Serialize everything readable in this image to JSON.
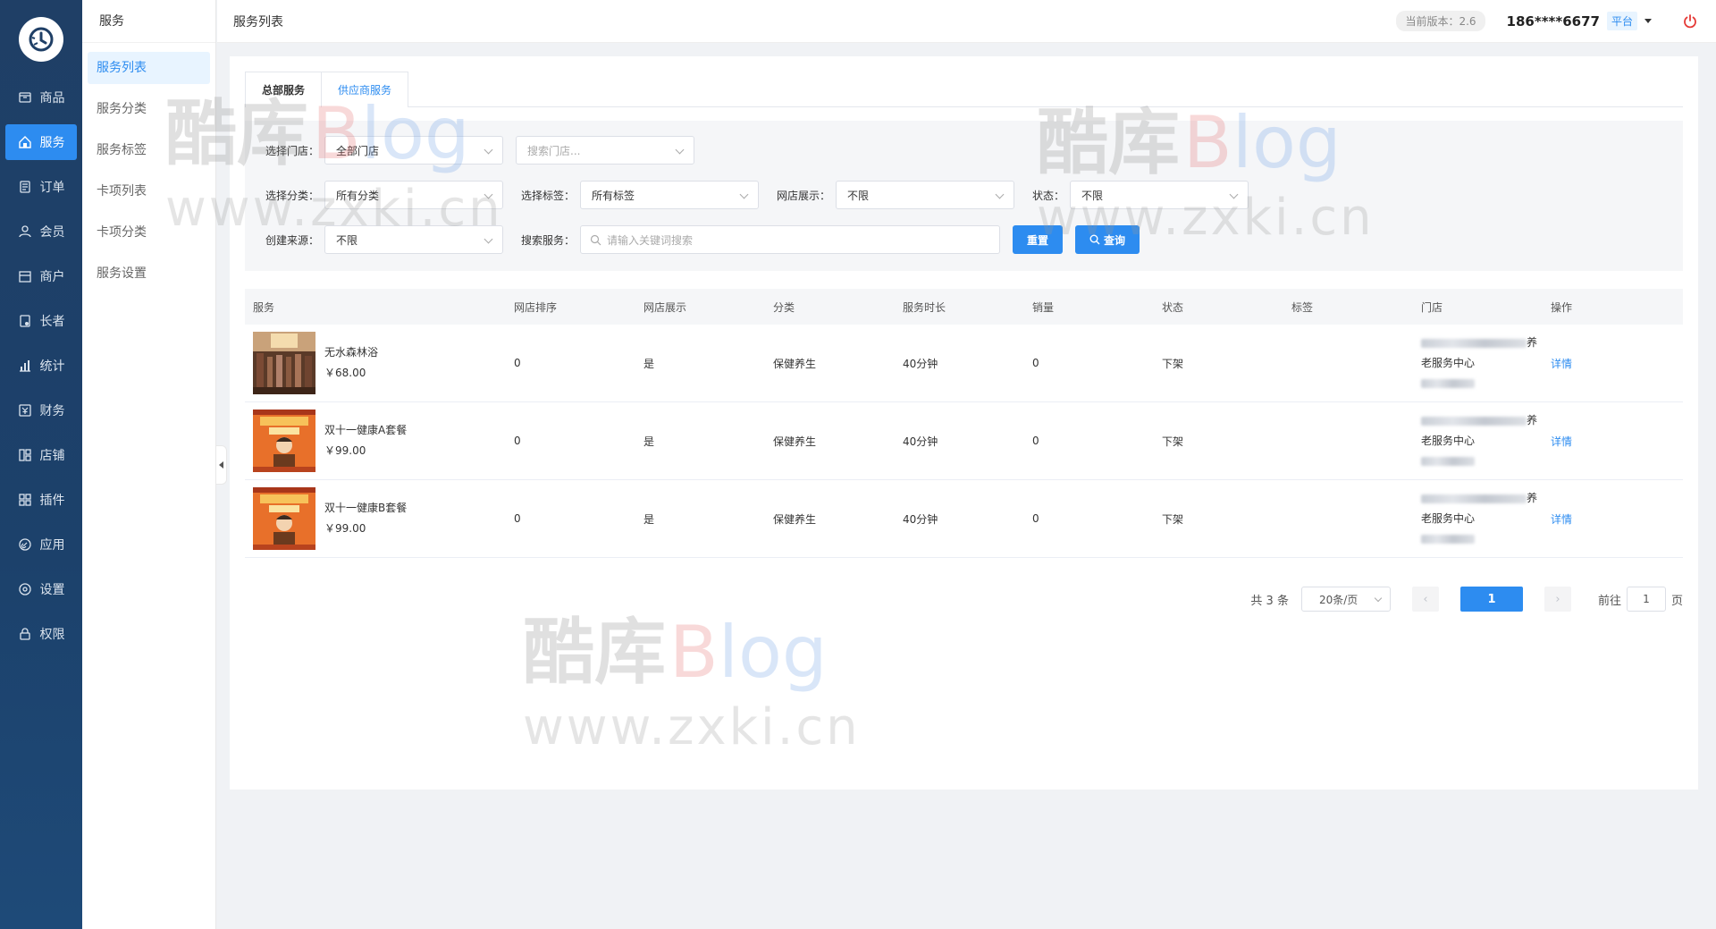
{
  "nav": {
    "items": [
      {
        "label": "商品",
        "icon": "goods-icon"
      },
      {
        "label": "服务",
        "icon": "home-icon",
        "active": true
      },
      {
        "label": "订单",
        "icon": "order-icon"
      },
      {
        "label": "会员",
        "icon": "user-icon"
      },
      {
        "label": "商户",
        "icon": "shop-icon"
      },
      {
        "label": "长者",
        "icon": "elder-icon"
      },
      {
        "label": "统计",
        "icon": "chart-icon"
      },
      {
        "label": "财务",
        "icon": "finance-icon"
      },
      {
        "label": "店铺",
        "icon": "store-icon"
      },
      {
        "label": "插件",
        "icon": "plugin-icon"
      },
      {
        "label": "应用",
        "icon": "app-icon"
      },
      {
        "label": "设置",
        "icon": "gear-icon"
      },
      {
        "label": "权限",
        "icon": "lock-icon"
      }
    ]
  },
  "submenu": {
    "title": "服务",
    "items": [
      "服务列表",
      "服务分类",
      "服务标签",
      "卡项列表",
      "卡项分类",
      "服务设置"
    ]
  },
  "header": {
    "title": "服务列表",
    "version": "当前版本：2.6",
    "user": "186****6677",
    "platform": "平台"
  },
  "tabs": [
    "总部服务",
    "供应商服务"
  ],
  "filters": {
    "store_label": "选择门店：",
    "store_value": "全部门店",
    "store_search_placeholder": "搜索门店...",
    "category_label": "选择分类：",
    "category_value": "所有分类",
    "tag_label": "选择标签：",
    "tag_value": "所有标签",
    "display_label": "网店展示：",
    "display_value": "不限",
    "status_label": "状态：",
    "status_value": "不限",
    "source_label": "创建来源：",
    "source_value": "不限",
    "search_label": "搜索服务：",
    "search_placeholder": "请输入关键词搜索",
    "reset_label": "重置",
    "query_label": "查询"
  },
  "table": {
    "columns": [
      "服务",
      "网店排序",
      "网店展示",
      "分类",
      "服务时长",
      "销量",
      "状态",
      "标签",
      "门店",
      "操作"
    ],
    "rows": [
      {
        "name": "无水森林浴",
        "price": "￥68.00",
        "sort": "0",
        "display": "是",
        "category": "保健养生",
        "duration": "40分钟",
        "sales": "0",
        "status": "下架",
        "tag": "",
        "store_suffix": "养",
        "store_line2": "老服务中心",
        "action": "详情"
      },
      {
        "name": "双十一健康A套餐",
        "price": "￥99.00",
        "sort": "0",
        "display": "是",
        "category": "保健养生",
        "duration": "40分钟",
        "sales": "0",
        "status": "下架",
        "tag": "",
        "store_suffix": "养",
        "store_line2": "老服务中心",
        "action": "详情"
      },
      {
        "name": "双十一健康B套餐",
        "price": "￥99.00",
        "sort": "0",
        "display": "是",
        "category": "保健养生",
        "duration": "40分钟",
        "sales": "0",
        "status": "下架",
        "tag": "",
        "store_suffix": "养",
        "store_line2": "老服务中心",
        "action": "详情"
      }
    ]
  },
  "pager": {
    "total": "共 3 条",
    "page_size": "20条/页",
    "current": "1",
    "goto_prefix": "前往",
    "goto_value": "1",
    "goto_suffix": "页"
  },
  "watermark": {
    "cn": "酷库",
    "blog_b": "B",
    "blog_l": "l",
    "blog_og": "og",
    "url": "www.zxki.cn"
  },
  "colors": {
    "primary": "#2d8cf0",
    "nav_bg": "#1f3f66",
    "danger": "#e53935"
  }
}
